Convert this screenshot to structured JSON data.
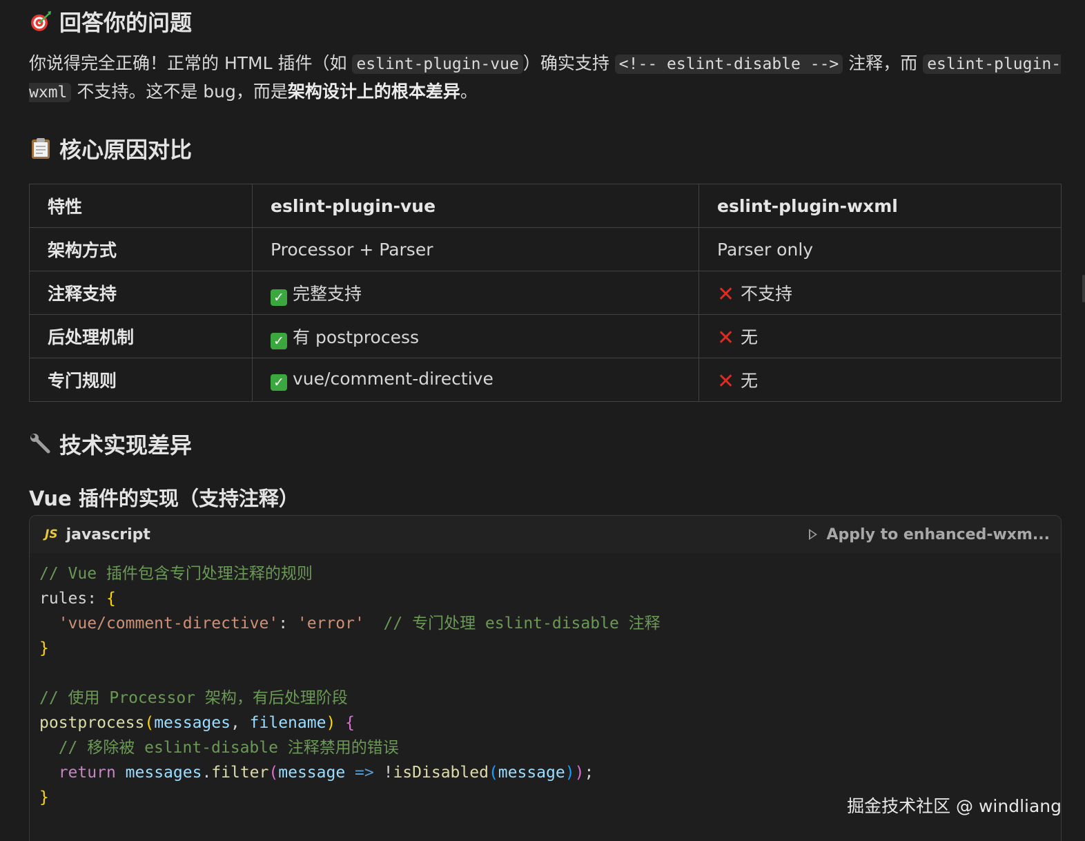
{
  "heading1": {
    "icon": "target-icon",
    "text": "回答你的问题"
  },
  "intro": {
    "t1": "你说得完全正确！正常的 HTML 插件（如 ",
    "code1": "eslint-plugin-vue",
    "t2": "）确实支持 ",
    "code2": "<!-- eslint-disable -->",
    "t3": " 注释，而 ",
    "code3": "eslint-plugin-wxml",
    "t4": " 不支持。这不是 bug，而是",
    "bold": "架构设计上的根本差异",
    "t5": "。"
  },
  "heading2": {
    "icon": "clipboard-icon",
    "text": "核心原因对比"
  },
  "table": {
    "headers": [
      "特性",
      "eslint-plugin-vue",
      "eslint-plugin-wxml"
    ],
    "rows": [
      {
        "feature": "架构方式",
        "vue": "Processor + Parser",
        "wxml": "Parser only"
      },
      {
        "feature": "注释支持",
        "vue": "完整支持",
        "wxml": "不支持"
      },
      {
        "feature": "后处理机制",
        "vue": "有 postprocess",
        "wxml": "无"
      },
      {
        "feature": "专门规则",
        "vue": "vue/comment-directive",
        "wxml": "无"
      }
    ]
  },
  "heading3": {
    "icon": "wrench-icon",
    "text": "技术实现差异"
  },
  "subheading": "Vue 插件的实现（支持注释）",
  "code_block": {
    "badge": "JS",
    "language": "javascript",
    "apply_label": "Apply to enhanced-wxm..."
  },
  "watermark": "掘金技术社区 @ windliang",
  "colors": {
    "background": "#1c1c1c",
    "check_green": "#3aa83f",
    "cross_red": "#e02b20",
    "comment_green": "#6a9955"
  }
}
